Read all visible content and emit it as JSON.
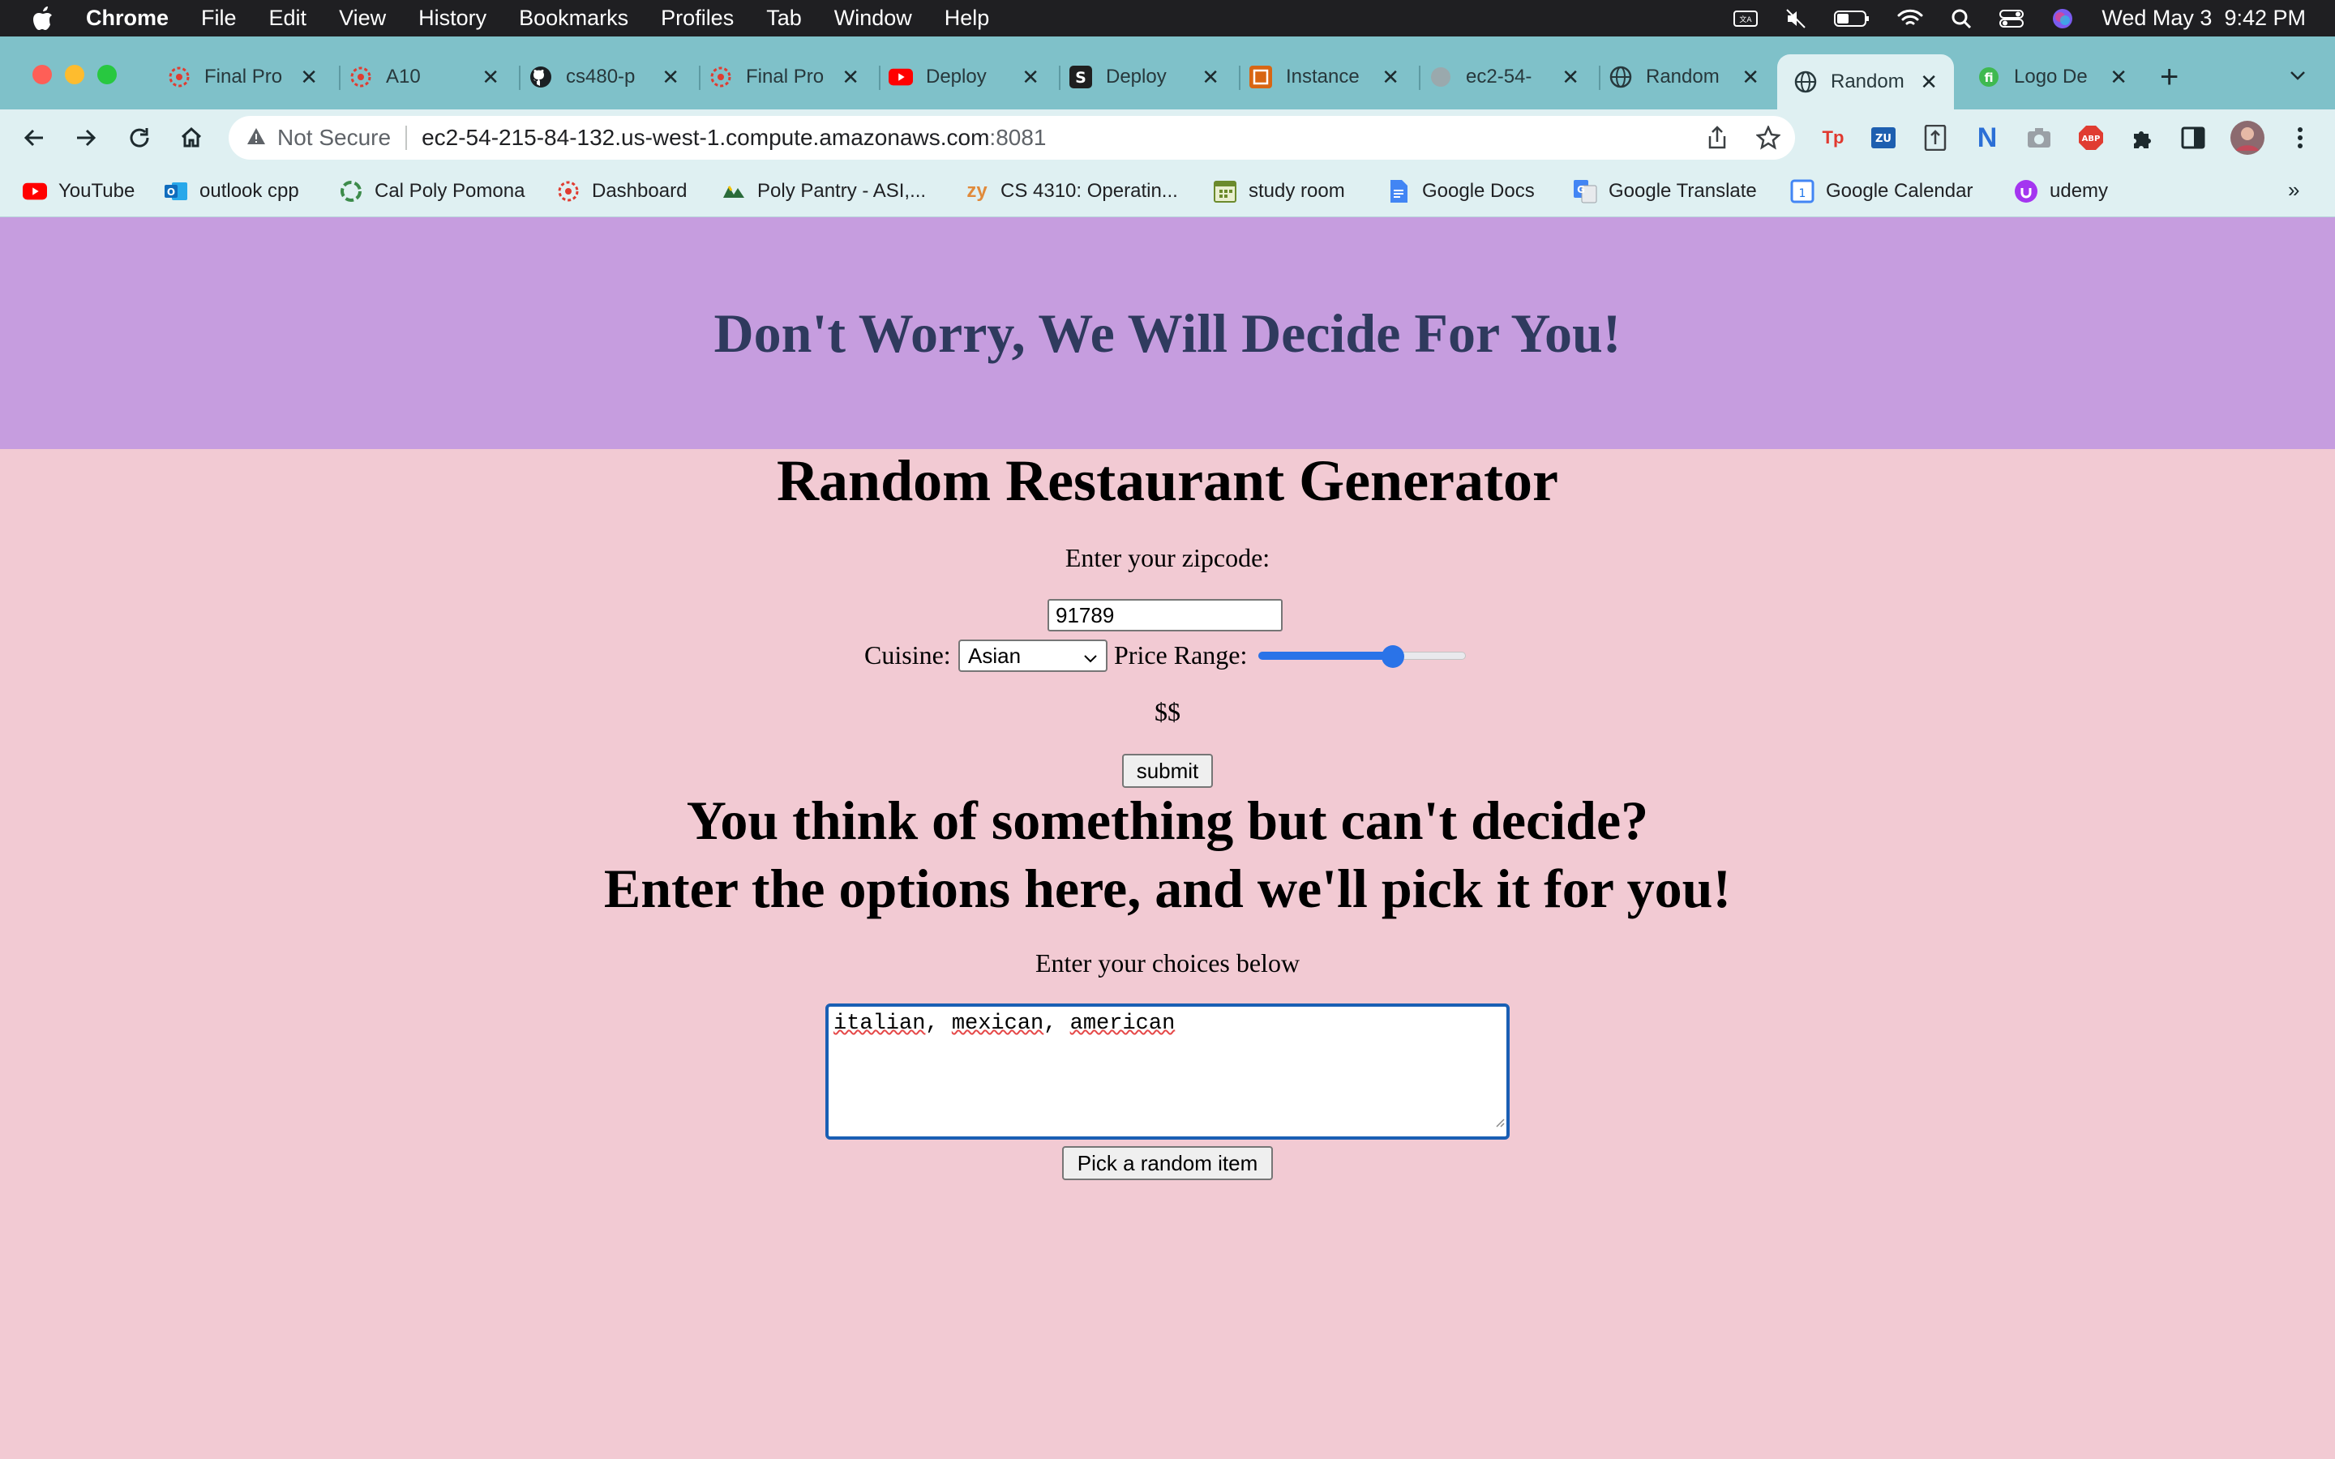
{
  "menubar": {
    "app": "Chrome",
    "items": [
      "File",
      "Edit",
      "View",
      "History",
      "Bookmarks",
      "Profiles",
      "Tab",
      "Window",
      "Help"
    ],
    "datetime": "Wed May 3  9:42 PM"
  },
  "tabs": [
    {
      "label": "Final Pro",
      "icon": "canvas-icon"
    },
    {
      "label": "A10",
      "icon": "canvas-icon"
    },
    {
      "label": "cs480-p",
      "icon": "github-icon"
    },
    {
      "label": "Final Pro",
      "icon": "canvas-icon"
    },
    {
      "label": "Deploy",
      "icon": "youtube-icon"
    },
    {
      "label": "Deploy",
      "icon": "s-icon"
    },
    {
      "label": "Instance",
      "icon": "aws-icon"
    },
    {
      "label": "ec2-54-",
      "icon": "globe-icon"
    },
    {
      "label": "Random",
      "icon": "globe-icon"
    },
    {
      "label": "Random",
      "icon": "globe-icon",
      "active": true
    },
    {
      "label": "Logo De",
      "icon": "logo-icon"
    }
  ],
  "address_bar": {
    "security": "Not Secure",
    "host": "ec2-54-215-84-132.us-west-1.compute.amazonaws.com",
    "port": ":8081"
  },
  "bookmarks": [
    "YouTube",
    "outlook cpp",
    "Cal Poly Pomona",
    "Dashboard",
    "Poly Pantry - ASI,...",
    "CS 4310: Operatin...",
    "study room",
    "Google Docs",
    "Google Translate",
    "Google Calendar",
    "udemy"
  ],
  "page": {
    "banner_title": "Don't Worry, We Will Decide For You!",
    "title": "Random Restaurant Generator",
    "zip_label": "Enter your zipcode:",
    "zip_value": "91789",
    "cuisine_label": "Cuisine:",
    "cuisine_value": "Asian",
    "price_label": "Price Range:",
    "price_slider_fraction": 0.65,
    "price_value": "$$",
    "submit_label": "submit",
    "decide_line1": "You think of something but can't decide?",
    "decide_line2": "Enter the options here, and we'll pick it for you!",
    "choices_label": "Enter your choices below",
    "choices_words": [
      "italian",
      "mexican",
      "american"
    ],
    "pick_label": "Pick a random item"
  },
  "colors": {
    "banner_bg": "#c69ddf",
    "page_bg": "#f2cad3",
    "banner_text": "#2f3a5e",
    "tab_strip": "#7fc1c9",
    "toolbar": "#dff0f2",
    "slider_accent": "#2a73e8"
  }
}
